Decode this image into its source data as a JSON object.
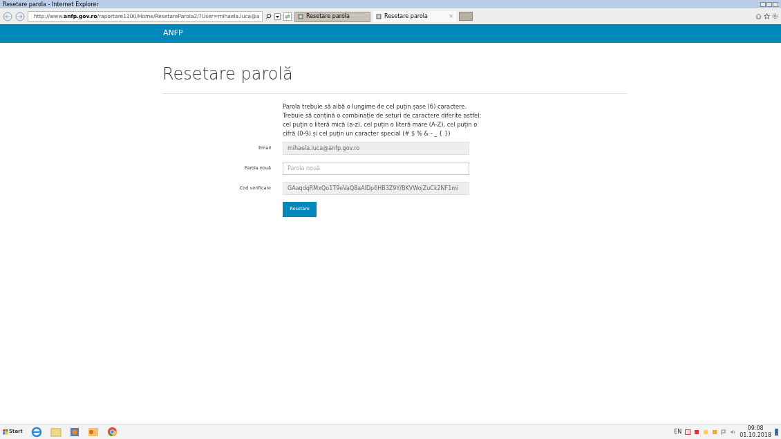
{
  "window": {
    "title": "Resetare parola - Internet Explorer"
  },
  "address_bar": {
    "url_prefix": "http://www.",
    "url_domain": "anfp.gov.ro",
    "url_rest": "/raportare1200/Home/ResetareParola2/?User=mihaela.luca@a"
  },
  "tabs": [
    {
      "label": "Resetare parola",
      "selected": false
    },
    {
      "label": "Resetare parola",
      "selected": true,
      "close": "×"
    }
  ],
  "navbar": {
    "brand": "ANFP"
  },
  "page": {
    "heading": "Resetare parolă",
    "instructions": "Parola trebuie să aibă o lungime de cel puțin șase (6) caractere. Trebuie să conțină o combinație de seturi de caractere diferite astfel: cel puțin o literă mică (a-z), cel puțin o literă mare (A-Z), cel puțin o cifră (0-9) și cel puțin un caracter special (# $ % & - _ { })",
    "fields": [
      {
        "label": "Email",
        "value": "mihaela.luca@anfp.gov.ro",
        "disabled": true
      },
      {
        "label": "Parola nouă",
        "placeholder": "Parola nouă",
        "disabled": false
      },
      {
        "label": "Cod verificare",
        "value": "GAaqdqRMxQo1T9eVaQ8aAlDp6HB3Z9Y/BKVWojZuCk2NF1mi",
        "disabled": true
      }
    ],
    "submit": "Resetare"
  },
  "taskbar": {
    "start": "Start",
    "language": "EN",
    "time": "09:08",
    "date": "01.10.2018"
  }
}
